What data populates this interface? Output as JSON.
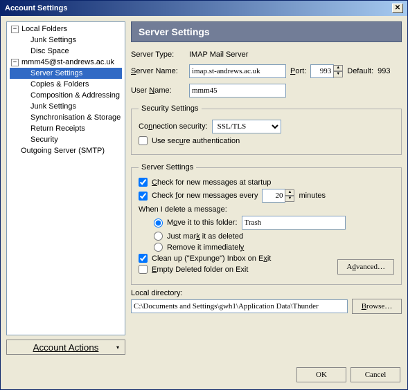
{
  "window": {
    "title": "Account Settings"
  },
  "tree": {
    "localFolders": {
      "label": "Local Folders",
      "expanded": "−",
      "items": [
        {
          "label": "Junk Settings"
        },
        {
          "label": "Disc Space"
        }
      ]
    },
    "account": {
      "label": "mmm45@st-andrews.ac.uk",
      "expanded": "−",
      "items": [
        {
          "label": "Server Settings",
          "selected": true
        },
        {
          "label": "Copies & Folders"
        },
        {
          "label": "Composition & Addressing"
        },
        {
          "label": "Junk Settings"
        },
        {
          "label": "Synchronisation & Storage"
        },
        {
          "label": "Return Receipts"
        },
        {
          "label": "Security"
        }
      ]
    },
    "outgoing": "Outgoing Server (SMTP)"
  },
  "accountActions": "Account Actions",
  "header": "Server Settings",
  "serverType": {
    "label": "Server Type:",
    "value": "IMAP Mail Server"
  },
  "serverName": {
    "label": "Server Name:",
    "value": "imap.st-andrews.ac.uk"
  },
  "port": {
    "label": "Port:",
    "value": "993"
  },
  "defaultPort": {
    "label": "Default:",
    "value": "993"
  },
  "userName": {
    "label": "User Name:",
    "value": "mmm45"
  },
  "security": {
    "legend": "Security Settings",
    "connSecLabel": "Connection security:",
    "connSecValue": "SSL/TLS",
    "useSecureAuth": "Use secure authentication"
  },
  "server": {
    "legend": "Server Settings",
    "checkStartup": "Check for new messages at startup",
    "checkEveryPrefix": "Check for new messages every",
    "checkEveryValue": "20",
    "checkEverySuffix": "minutes",
    "whenDelete": "When I delete a message:",
    "optMove": "Move it to this folder:",
    "optMoveValue": "Trash",
    "optMark": "Just mark it as deleted",
    "optRemove": "Remove it immediately",
    "cleanup": "Clean up (\"Expunge\") Inbox on Exit",
    "emptyDeleted": "Empty Deleted folder on Exit",
    "advanced": "Advanced…"
  },
  "localDir": {
    "label": "Local directory:",
    "value": "C:\\Documents and Settings\\gwh1\\Application Data\\Thunder",
    "browse": "Browse…"
  },
  "buttons": {
    "ok": "OK",
    "cancel": "Cancel"
  }
}
